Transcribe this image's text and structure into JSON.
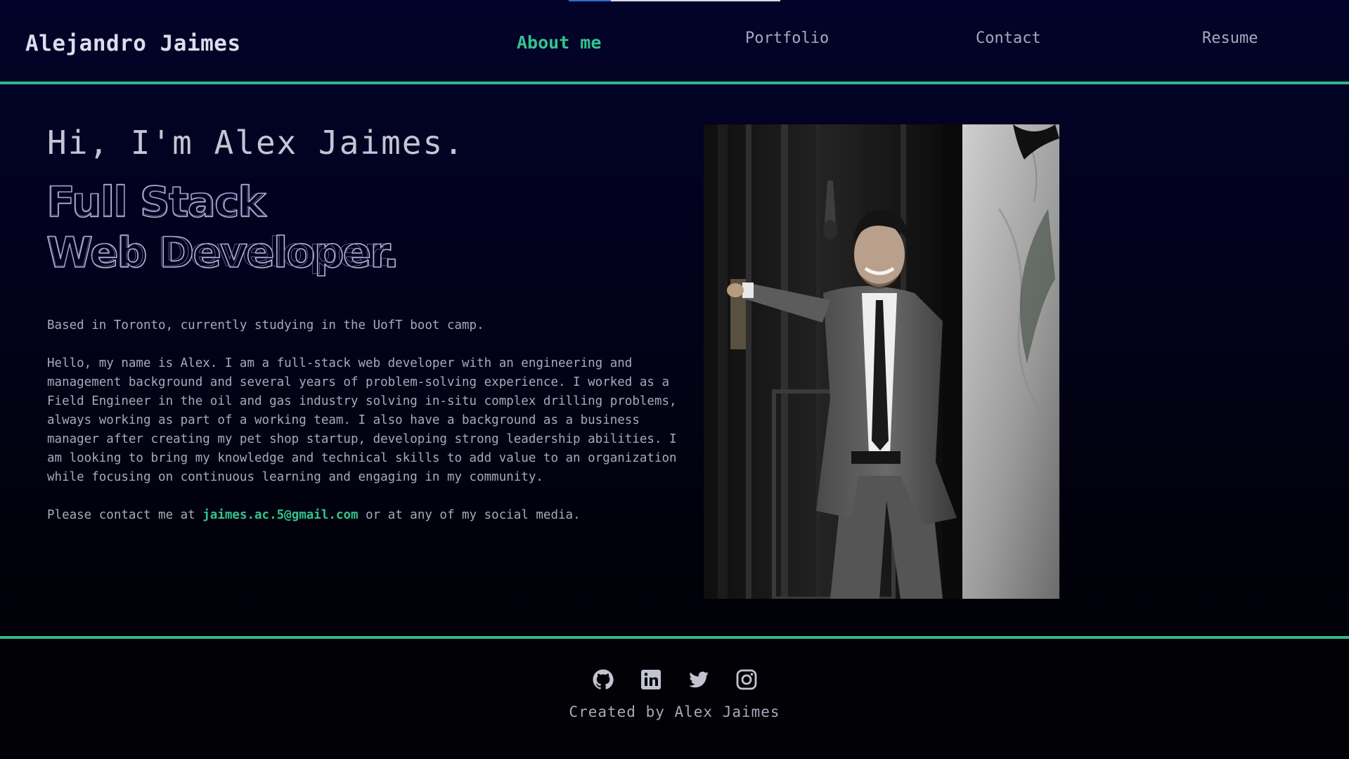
{
  "progress": {
    "fraction": 0.2
  },
  "header": {
    "brand": "Alejandro Jaimes",
    "nav": [
      {
        "label": "About me",
        "active": true
      },
      {
        "label": "Portfolio",
        "active": false
      },
      {
        "label": "Contact",
        "active": false
      },
      {
        "label": "Resume",
        "active": false
      }
    ]
  },
  "about": {
    "greeting": "Hi, I'm Alex Jaimes.",
    "title_line1": "Full Stack",
    "title_line2": "Web Developer.",
    "intro": "Based in Toronto, currently studying in the UofT boot camp.",
    "bio": "Hello, my name is Alex. I am a full-stack web developer with an engineering and management background and several years of problem-solving experience. I worked as a Field Engineer in the oil and gas industry solving in-situ complex drilling problems, always working as part of a working team. I also have a background as a business manager after creating my pet shop startup, developing strong leadership abilities. I am looking to bring my knowledge and technical skills to add value to an organization while focusing on continuous learning and engaging in my community.",
    "contact_prefix": "Please contact me at ",
    "email": "jaimes.ac.5@gmail.com",
    "contact_suffix": " or at any of my social media."
  },
  "footer": {
    "social_icons": [
      "github-icon",
      "linkedin-icon",
      "twitter-icon",
      "instagram-icon"
    ],
    "credit": "Created by Alex Jaimes"
  },
  "colors": {
    "accent": "#34c38f",
    "background": "#02021d",
    "text": "#a9a9bb",
    "title_stroke": "#b9b4dd"
  }
}
